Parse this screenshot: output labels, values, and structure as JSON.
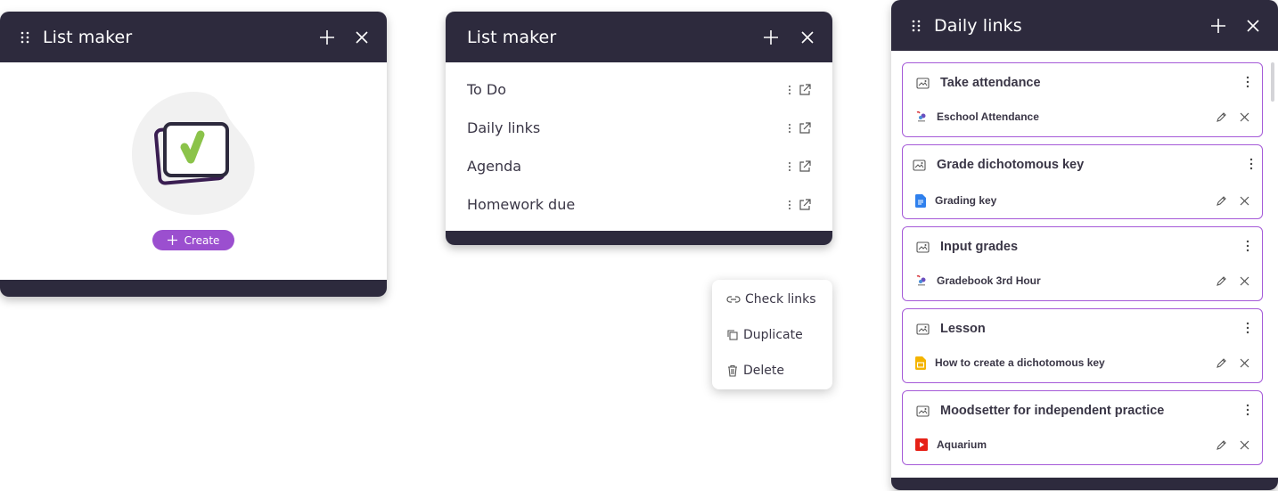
{
  "panel_empty": {
    "title": "List maker",
    "create_label": "Create"
  },
  "panel_lists": {
    "title": "List maker",
    "items": [
      {
        "label": "To Do"
      },
      {
        "label": "Daily links"
      },
      {
        "label": "Agenda"
      },
      {
        "label": "Homework due"
      }
    ]
  },
  "context_menu": {
    "items": [
      {
        "label": "Check links",
        "icon": "link-check-icon"
      },
      {
        "label": "Duplicate",
        "icon": "duplicate-icon"
      },
      {
        "label": "Delete",
        "icon": "trash-icon"
      }
    ]
  },
  "panel_links": {
    "title": "Daily links",
    "cards": [
      {
        "title": "Take attendance",
        "link": "Eschool Attendance",
        "link_icon": "eschool-icon"
      },
      {
        "title": "Grade dichotomous key",
        "link": "Grading key",
        "link_icon": "google-docs-icon"
      },
      {
        "title": "Input grades",
        "link": "Gradebook 3rd Hour",
        "link_icon": "eschool-icon"
      },
      {
        "title": "Lesson",
        "link": "How to create a dichotomous key",
        "link_icon": "google-slides-icon"
      },
      {
        "title": "Moodsetter for independent practice",
        "link": "Aquarium",
        "link_icon": "youtube-icon"
      }
    ]
  },
  "colors": {
    "header": "#2d2a3d",
    "accent": "#9b4fcf",
    "card_border": "#a55ad8",
    "check_green": "#8bc34a"
  }
}
